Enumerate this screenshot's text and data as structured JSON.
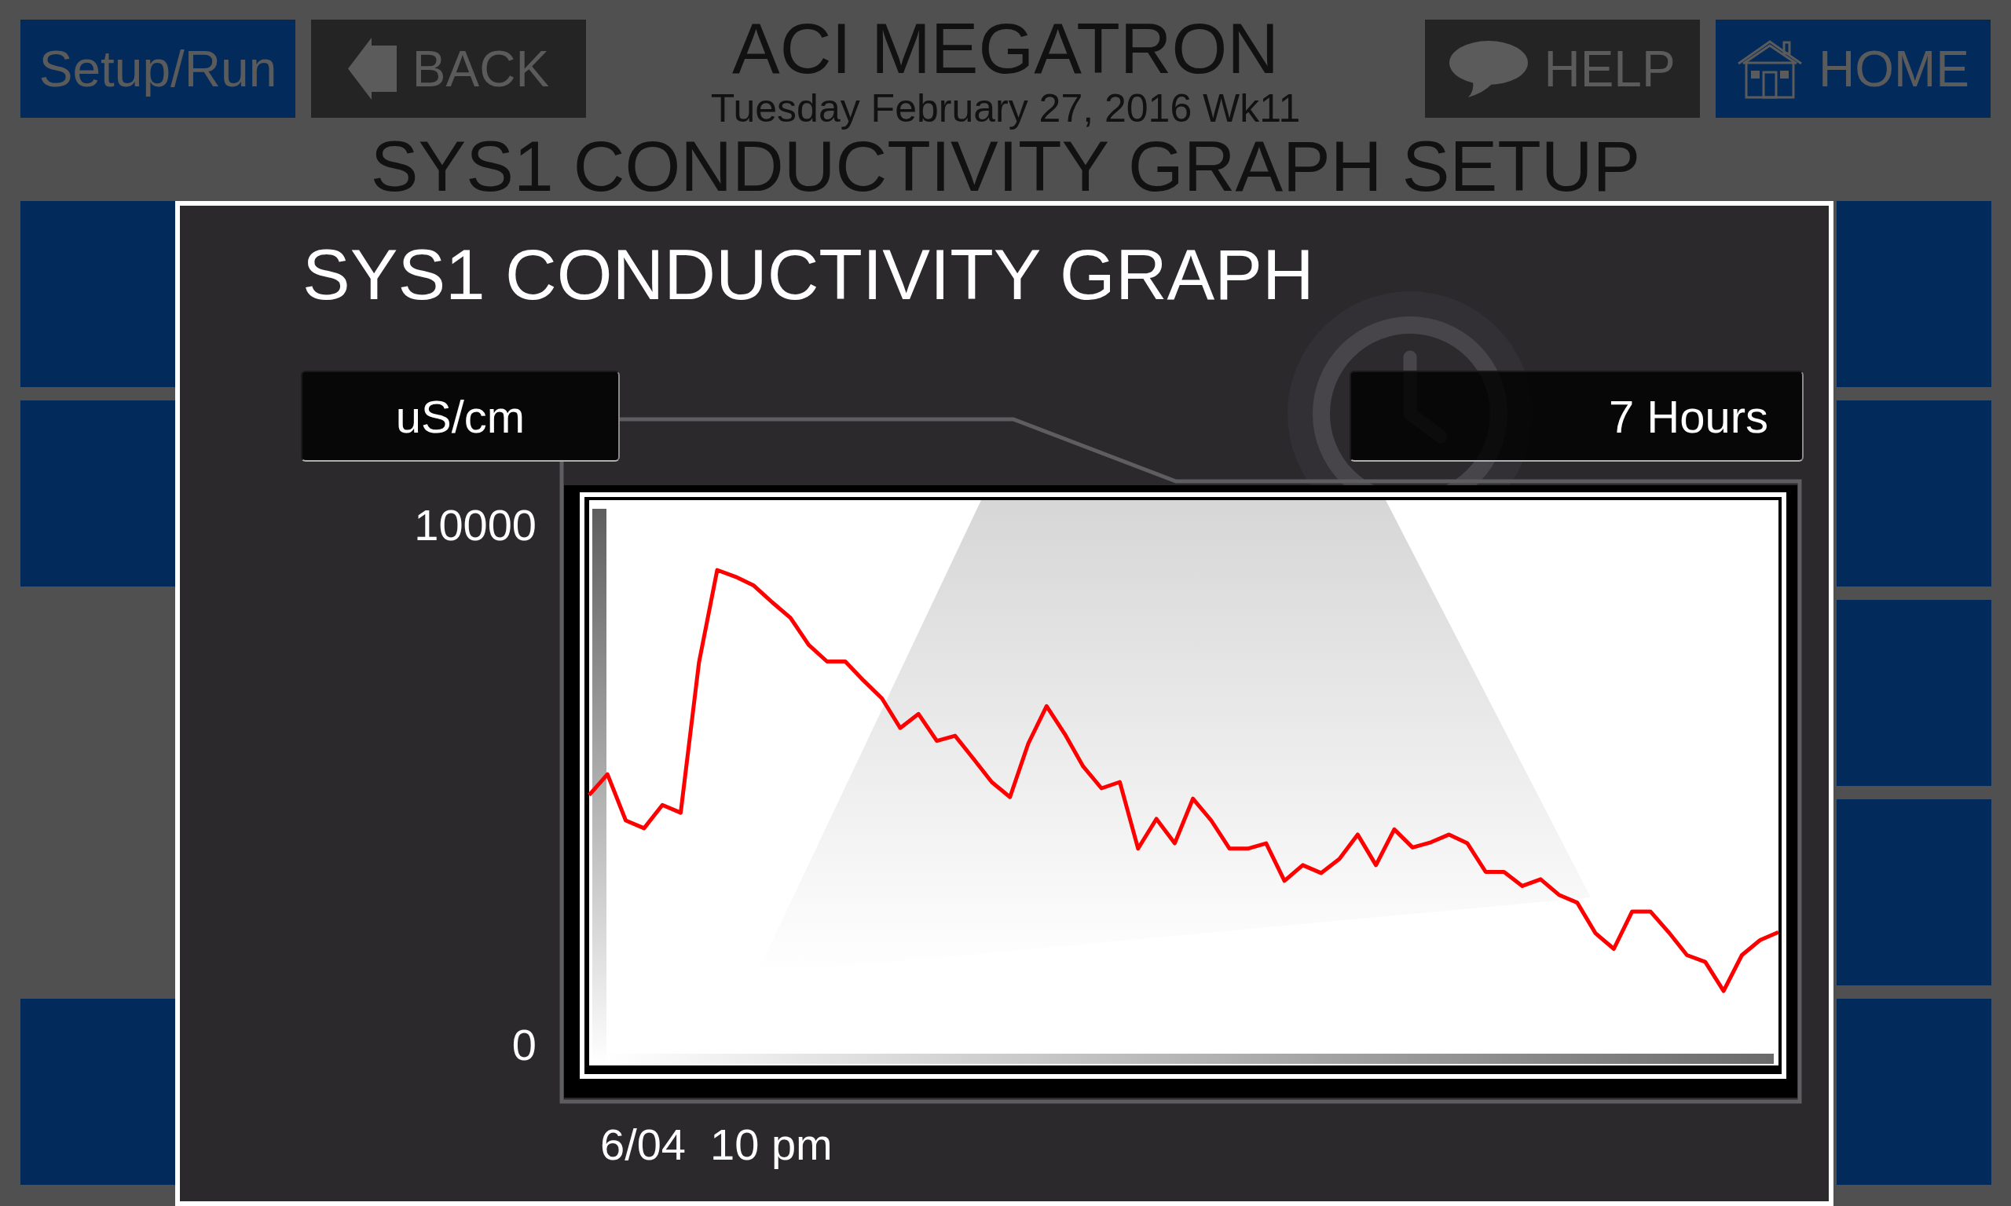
{
  "header": {
    "left_buttons": [
      {
        "label": "Setup/Run",
        "kind": "menu"
      },
      {
        "label": "BACK",
        "kind": "back"
      }
    ],
    "title": "ACI MEGATRON",
    "date": "Tuesday February 27, 2016 Wk11",
    "right_buttons": [
      {
        "label": "HELP",
        "kind": "help"
      },
      {
        "label": "HOME",
        "kind": "home"
      }
    ],
    "page_title": "SYS1 CONDUCTIVITY GRAPH SETUP"
  },
  "side_tiles": {
    "left": [
      {
        "kind": "button"
      },
      {
        "kind": "button"
      },
      {
        "kind": "gap"
      },
      {
        "kind": "gap"
      },
      {
        "kind": "button"
      }
    ],
    "right": [
      {
        "kind": "button"
      },
      {
        "kind": "button"
      },
      {
        "kind": "button"
      },
      {
        "kind": "button"
      },
      {
        "kind": "button"
      }
    ]
  },
  "dialog": {
    "title": "SYS1 CONDUCTIVITY GRAPH",
    "unit_selector": {
      "value": "uS/cm"
    },
    "range_selector": {
      "value": "7 Hours"
    },
    "chart_data": {
      "type": "line",
      "series": [
        {
          "color": "#ff0000",
          "values": [
            4810,
            5210,
            4320,
            4170,
            4620,
            4470,
            7360,
            9140,
            9010,
            8840,
            8520,
            8220,
            7700,
            7380,
            7380,
            7010,
            6670,
            6100,
            6370,
            5850,
            5950,
            5510,
            5060,
            4770,
            5800,
            6520,
            5980,
            5360,
            4940,
            5060,
            3780,
            4350,
            3880,
            4740,
            4320,
            3780,
            3780,
            3880,
            3160,
            3460,
            3310,
            3580,
            4050,
            3460,
            4150,
            3800,
            3900,
            4050,
            3880,
            3330,
            3330,
            3060,
            3190,
            2890,
            2740,
            2150,
            1850,
            2570,
            2570,
            2170,
            1730,
            1600,
            1040,
            1730,
            2020,
            2170
          ]
        }
      ],
      "ylim": [
        -1088,
        11224
      ],
      "yticks": [
        {
          "value": 0,
          "label": "0"
        },
        {
          "value": 10000,
          "label": "10000"
        }
      ],
      "annotations": [
        "6/04  10 pm"
      ]
    }
  }
}
